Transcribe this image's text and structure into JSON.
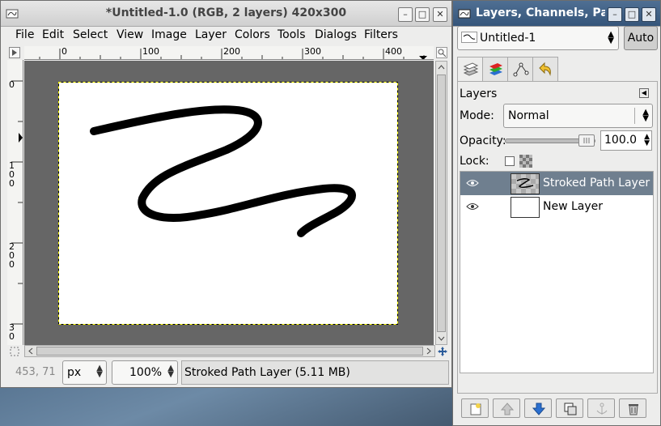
{
  "image_window": {
    "title": "*Untitled-1.0 (RGB, 2 layers) 420x300",
    "menus": [
      "File",
      "Edit",
      "Select",
      "View",
      "Image",
      "Layer",
      "Colors",
      "Tools",
      "Dialogs",
      "Filters"
    ],
    "ruler_top_ticks": [
      "0",
      "100",
      "200",
      "300",
      "400"
    ],
    "ruler_left_ticks": [
      "0",
      "1\n0\n0",
      "2\n0\n0",
      "3\n0"
    ],
    "status": {
      "pointer_coords": "453, 71",
      "unit": "px",
      "zoom": "100%",
      "message": "Stroked Path Layer (5.11 MB)"
    }
  },
  "layers_window": {
    "title": "Layers, Channels, Pat",
    "image_selector": "Untitled-1",
    "auto_button": "Auto",
    "tabs": [
      "layers-tab",
      "channels-tab",
      "paths-tab",
      "undo-history-tab"
    ],
    "panel_title": "Layers",
    "mode_label": "Mode:",
    "mode_value": "Normal",
    "opacity_label": "Opacity:",
    "opacity_value": "100.0",
    "lock_label": "Lock:",
    "layers": [
      {
        "name": "Stroked Path Layer",
        "visible": true,
        "selected": true
      },
      {
        "name": "New Layer",
        "visible": true,
        "selected": false
      }
    ],
    "bottom_buttons": [
      "new-layer",
      "raise-layer",
      "lower-layer",
      "duplicate-layer",
      "anchor-layer",
      "delete-layer"
    ]
  },
  "colors": {
    "selected_row": "#6f7f8f",
    "canvas_bg": "#666666",
    "layers_titlebar": "#3f6086"
  }
}
